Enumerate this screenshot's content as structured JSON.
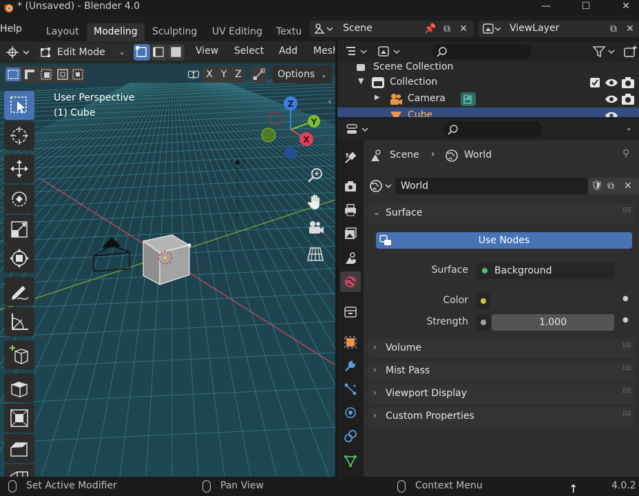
{
  "window": {
    "title": "* (Unsaved) - Blender 4.0",
    "minimize": "—",
    "maximize": "☐",
    "close": "✕"
  },
  "menu": {
    "help": "Help"
  },
  "workspace_tabs": [
    {
      "label": "Layout",
      "active": false
    },
    {
      "label": "Modeling",
      "active": true
    },
    {
      "label": "Sculpting",
      "active": false
    },
    {
      "label": "UV Editing",
      "active": false
    },
    {
      "label": "Textu",
      "active": false
    }
  ],
  "scene_selector": {
    "value": "Scene"
  },
  "viewlayer_selector": {
    "value": "ViewLayer"
  },
  "viewport": {
    "mode": "Edit Mode",
    "menus": [
      "View",
      "Select",
      "Add",
      "Mesh"
    ],
    "axes": [
      "X",
      "Y",
      "Z"
    ],
    "options_label": "Options",
    "perspective_label": "User Perspective",
    "object_label": "(1) Cube",
    "gizmo_axes": {
      "z": "Z",
      "y": "Y",
      "x": "X"
    }
  },
  "outliner": {
    "search_placeholder": "",
    "rows": [
      {
        "label": "Scene Collection"
      },
      {
        "label": "Collection"
      },
      {
        "label": "Camera"
      },
      {
        "label": "Cube"
      }
    ]
  },
  "properties": {
    "breadcrumb": {
      "scene": "Scene",
      "world": "World"
    },
    "world_name": "World",
    "panels": {
      "surface": "Surface",
      "use_nodes": "Use Nodes",
      "surface_label": "Surface",
      "surface_value": "Background",
      "color_label": "Color",
      "strength_label": "Strength",
      "strength_value": "1.000",
      "volume": "Volume",
      "mist_pass": "Mist Pass",
      "viewport_display": "Viewport Display",
      "custom_properties": "Custom Properties"
    }
  },
  "statusbar": {
    "left": "Set Active Modifier",
    "middle": "Pan View",
    "right": "Context Menu",
    "version": "4.0.2"
  },
  "colors": {
    "accent_blue": "#4772b3",
    "selected_row": "#334d80",
    "axis_x": "#e0405a",
    "axis_y": "#7fbf2e",
    "axis_z": "#3d7fe0",
    "grid": "#3a8a97",
    "viewport_bg": "#1f3a44"
  },
  "icons": {
    "blender_logo": "blender-logo-icon",
    "search": "search-icon",
    "eye": "eye-icon",
    "camera": "camera-icon",
    "world": "world-icon"
  }
}
